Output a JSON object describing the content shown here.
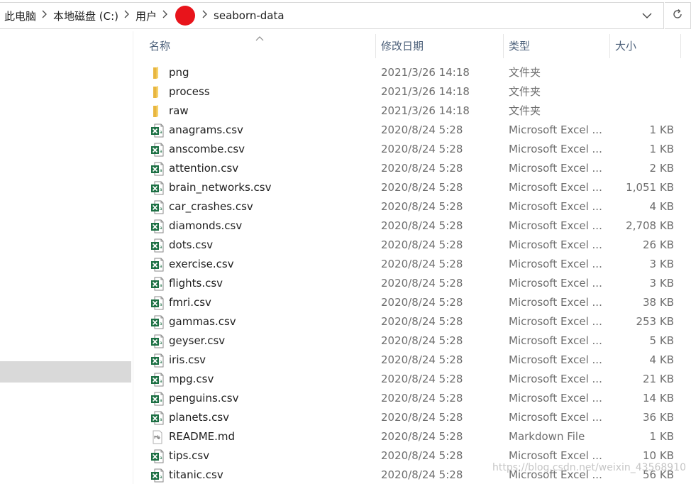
{
  "breadcrumb": {
    "items": [
      "此电脑",
      "本地磁盘 (C:)",
      "用户",
      "seaborn-data"
    ],
    "redacted_color": "#e8141b"
  },
  "columns": {
    "name": "名称",
    "date": "修改日期",
    "type": "类型",
    "size": "大小"
  },
  "files": [
    {
      "name": "png",
      "date": "2021/3/26 14:18",
      "type": "文件夹",
      "size": "",
      "icon": "folder-icon"
    },
    {
      "name": "process",
      "date": "2021/3/26 14:18",
      "type": "文件夹",
      "size": "",
      "icon": "folder-icon"
    },
    {
      "name": "raw",
      "date": "2021/3/26 14:18",
      "type": "文件夹",
      "size": "",
      "icon": "folder-icon"
    },
    {
      "name": "anagrams.csv",
      "date": "2020/8/24 5:28",
      "type": "Microsoft Excel ...",
      "size": "1 KB",
      "icon": "excel-csv-icon"
    },
    {
      "name": "anscombe.csv",
      "date": "2020/8/24 5:28",
      "type": "Microsoft Excel ...",
      "size": "1 KB",
      "icon": "excel-csv-icon"
    },
    {
      "name": "attention.csv",
      "date": "2020/8/24 5:28",
      "type": "Microsoft Excel ...",
      "size": "2 KB",
      "icon": "excel-csv-icon"
    },
    {
      "name": "brain_networks.csv",
      "date": "2020/8/24 5:28",
      "type": "Microsoft Excel ...",
      "size": "1,051 KB",
      "icon": "excel-csv-icon"
    },
    {
      "name": "car_crashes.csv",
      "date": "2020/8/24 5:28",
      "type": "Microsoft Excel ...",
      "size": "4 KB",
      "icon": "excel-csv-icon"
    },
    {
      "name": "diamonds.csv",
      "date": "2020/8/24 5:28",
      "type": "Microsoft Excel ...",
      "size": "2,708 KB",
      "icon": "excel-csv-icon"
    },
    {
      "name": "dots.csv",
      "date": "2020/8/24 5:28",
      "type": "Microsoft Excel ...",
      "size": "26 KB",
      "icon": "excel-csv-icon"
    },
    {
      "name": "exercise.csv",
      "date": "2020/8/24 5:28",
      "type": "Microsoft Excel ...",
      "size": "3 KB",
      "icon": "excel-csv-icon"
    },
    {
      "name": "flights.csv",
      "date": "2020/8/24 5:28",
      "type": "Microsoft Excel ...",
      "size": "3 KB",
      "icon": "excel-csv-icon"
    },
    {
      "name": "fmri.csv",
      "date": "2020/8/24 5:28",
      "type": "Microsoft Excel ...",
      "size": "38 KB",
      "icon": "excel-csv-icon"
    },
    {
      "name": "gammas.csv",
      "date": "2020/8/24 5:28",
      "type": "Microsoft Excel ...",
      "size": "253 KB",
      "icon": "excel-csv-icon"
    },
    {
      "name": "geyser.csv",
      "date": "2020/8/24 5:28",
      "type": "Microsoft Excel ...",
      "size": "5 KB",
      "icon": "excel-csv-icon"
    },
    {
      "name": "iris.csv",
      "date": "2020/8/24 5:28",
      "type": "Microsoft Excel ...",
      "size": "4 KB",
      "icon": "excel-csv-icon"
    },
    {
      "name": "mpg.csv",
      "date": "2020/8/24 5:28",
      "type": "Microsoft Excel ...",
      "size": "21 KB",
      "icon": "excel-csv-icon"
    },
    {
      "name": "penguins.csv",
      "date": "2020/8/24 5:28",
      "type": "Microsoft Excel ...",
      "size": "14 KB",
      "icon": "excel-csv-icon"
    },
    {
      "name": "planets.csv",
      "date": "2020/8/24 5:28",
      "type": "Microsoft Excel ...",
      "size": "36 KB",
      "icon": "excel-csv-icon"
    },
    {
      "name": "README.md",
      "date": "2020/8/24 5:28",
      "type": "Markdown File",
      "size": "1 KB",
      "icon": "markdown-file-icon"
    },
    {
      "name": "tips.csv",
      "date": "2020/8/24 5:28",
      "type": "Microsoft Excel ...",
      "size": "10 KB",
      "icon": "excel-csv-icon"
    },
    {
      "name": "titanic.csv",
      "date": "2020/8/24 5:28",
      "type": "Microsoft Excel ...",
      "size": "56 KB",
      "icon": "excel-csv-icon"
    }
  ],
  "watermark": "https://blog.csdn.net/weixin_43568910"
}
